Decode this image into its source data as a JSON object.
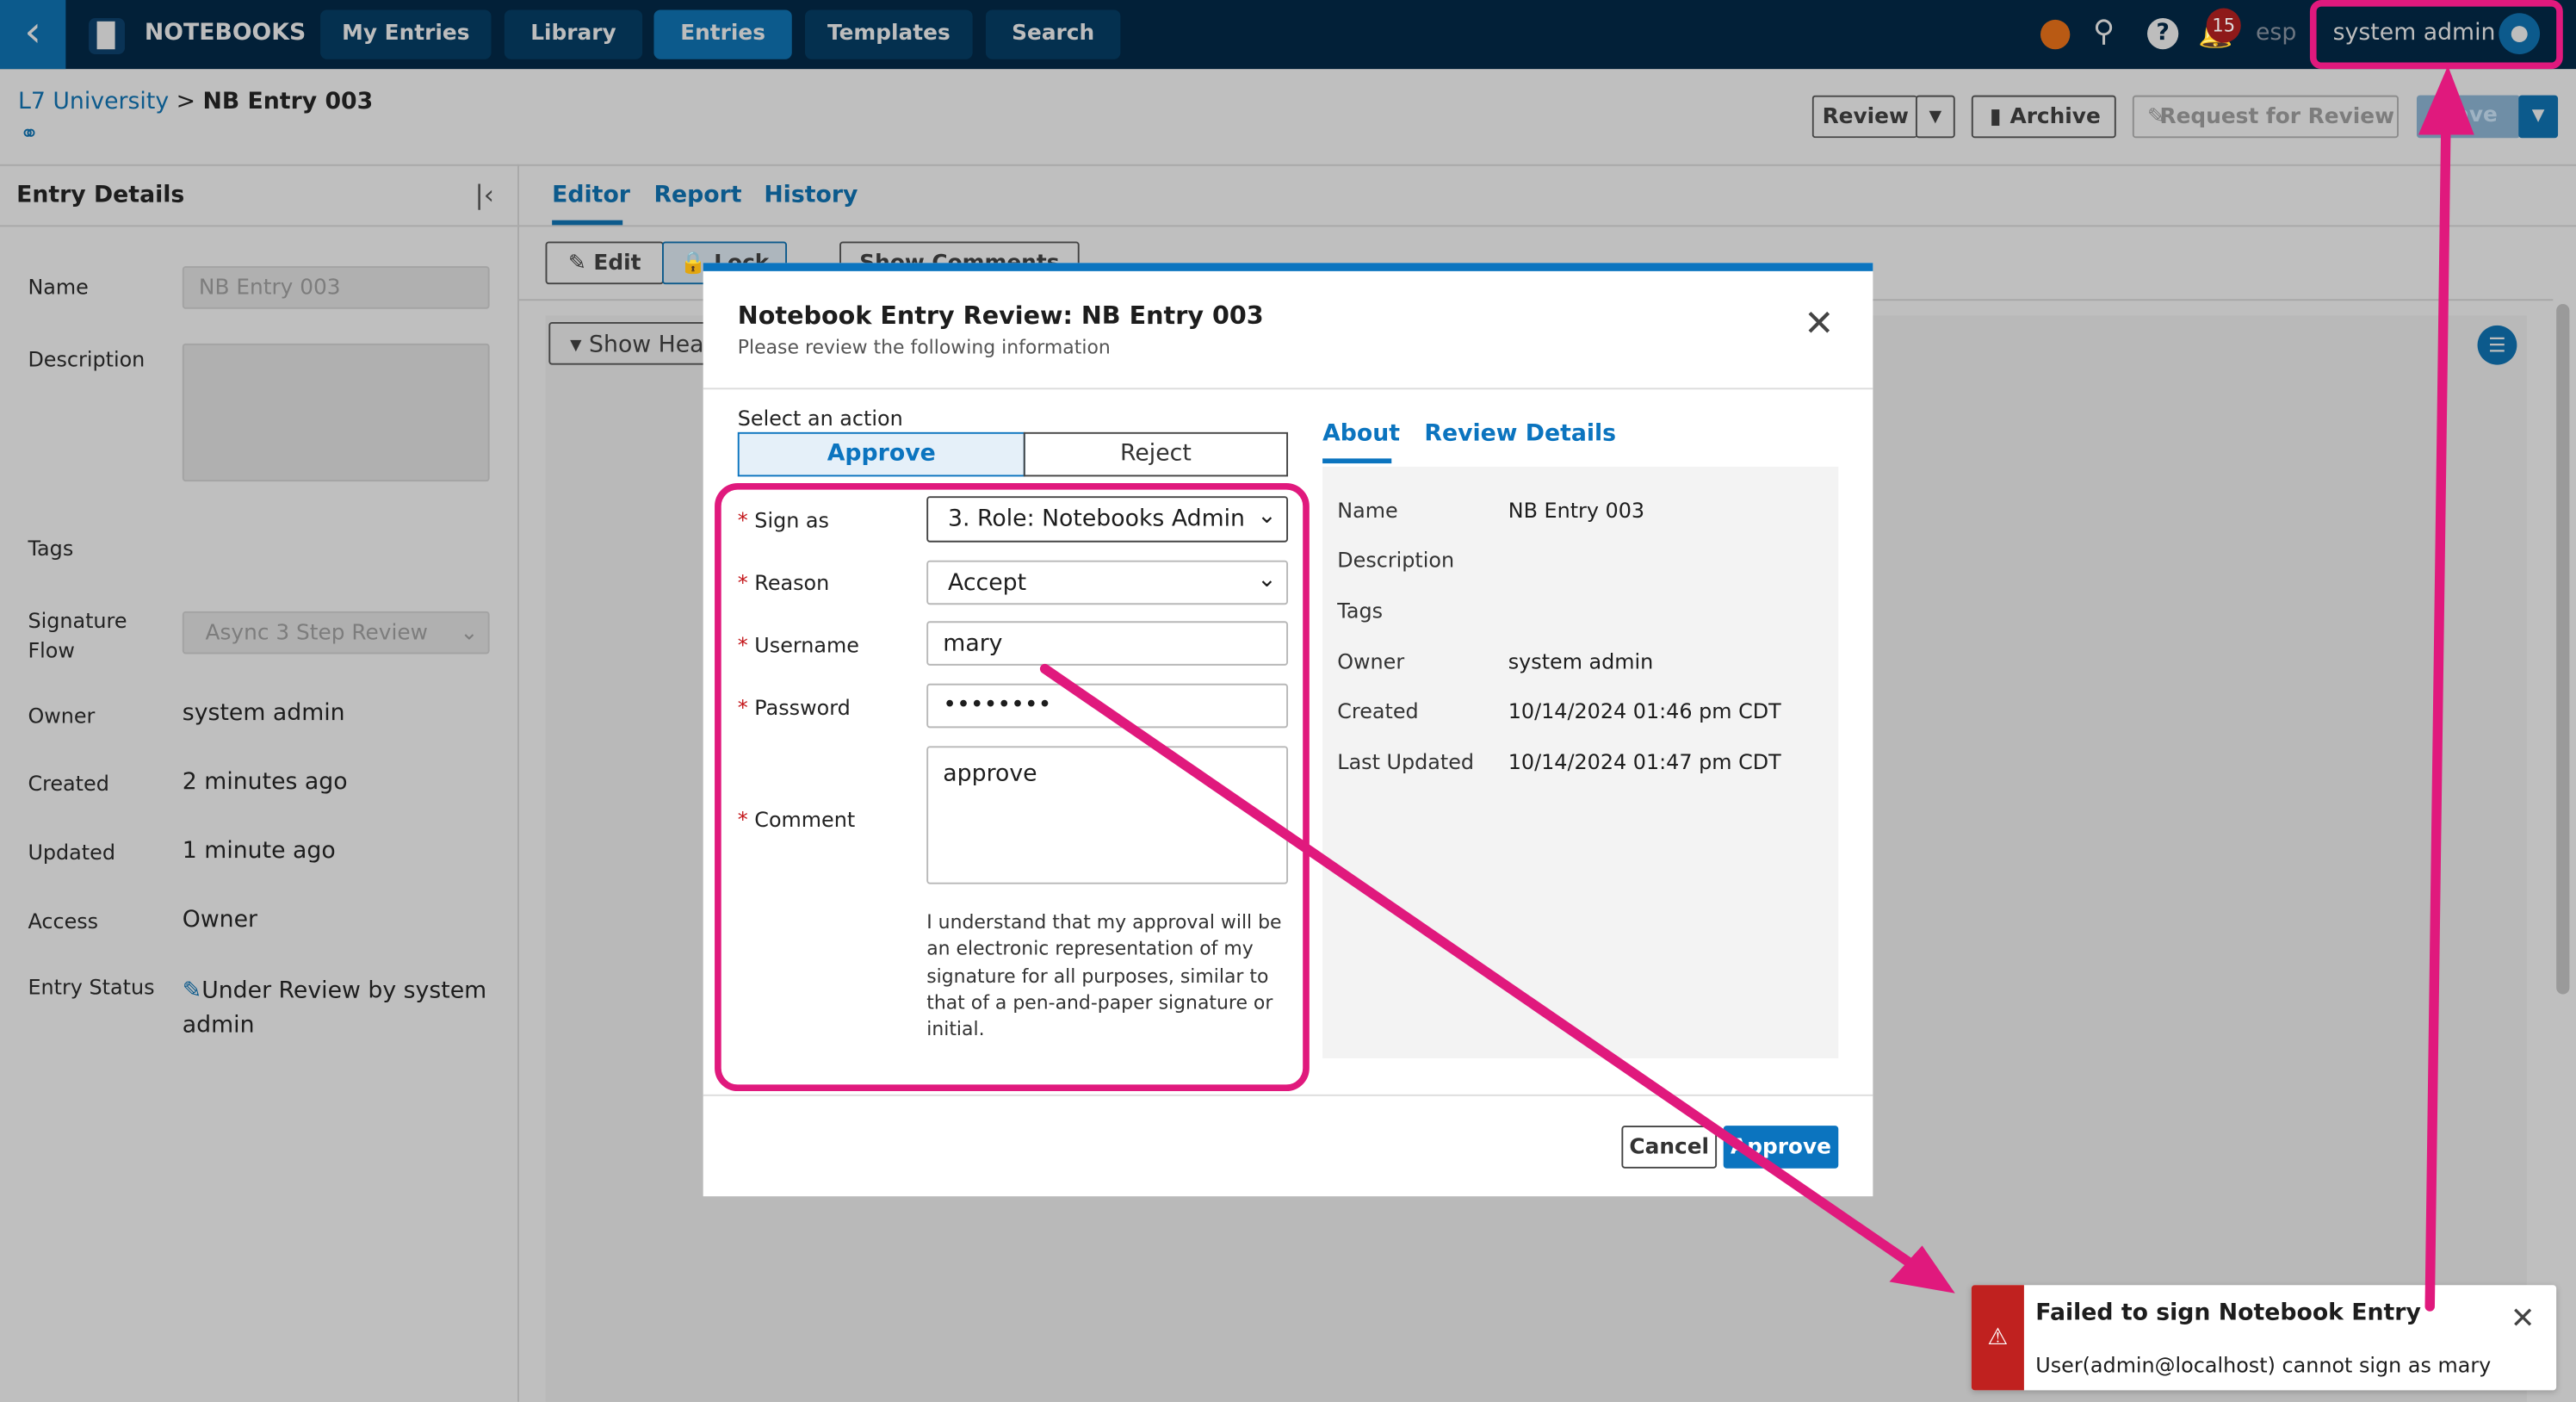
{
  "nav": {
    "brand": "NOTEBOOKS",
    "items": [
      "My Entries",
      "Library",
      "Entries",
      "Templates",
      "Search"
    ],
    "active": "Entries",
    "notification_count": "15",
    "language": "esp",
    "user": "system admin"
  },
  "breadcrumb": {
    "parent": "L7 University",
    "separator": ">",
    "current": "NB Entry 003"
  },
  "toolbar": {
    "review": "Review",
    "archive": "Archive",
    "request_review": "Request for Review",
    "save": "Save"
  },
  "sidebar": {
    "title": "Entry Details",
    "fields": {
      "name_label": "Name",
      "name_value": "NB Entry 003",
      "description_label": "Description",
      "tags_label": "Tags",
      "signature_flow_label": "Signature Flow",
      "signature_flow_value": "Async 3 Step Review",
      "owner_label": "Owner",
      "owner_value": "system admin",
      "created_label": "Created",
      "created_value": "2 minutes ago",
      "updated_label": "Updated",
      "updated_value": "1 minute ago",
      "access_label": "Access",
      "access_value": "Owner",
      "status_label": "Entry Status",
      "status_value": "Under Review by system admin"
    }
  },
  "tabs": [
    "Editor",
    "Report",
    "History"
  ],
  "editor": {
    "edit": "Edit",
    "lock": "Lock",
    "show_comments": "Show Comments",
    "show_header": "Show Header"
  },
  "modal": {
    "title": "Notebook Entry Review: NB Entry 003",
    "subtitle": "Please review the following information",
    "select_action": "Select an action",
    "actions": [
      "Approve",
      "Reject"
    ],
    "selected_action": "Approve",
    "form": {
      "sign_as_label": "Sign as",
      "sign_as_value": "3. Role: Notebooks Admin",
      "reason_label": "Reason",
      "reason_value": "Accept",
      "username_label": "Username",
      "username_value": "mary",
      "password_label": "Password",
      "password_value": "••••••••",
      "comment_label": "Comment",
      "comment_value": "approve",
      "disclaimer": "I understand that my approval will be an electronic representation of my signature for all purposes, similar to that of a pen-and-paper signature or initial."
    },
    "info_tabs": [
      "About",
      "Review Details"
    ],
    "about": [
      {
        "label": "Name",
        "value": "NB Entry 003"
      },
      {
        "label": "Description",
        "value": ""
      },
      {
        "label": "Tags",
        "value": ""
      },
      {
        "label": "Owner",
        "value": "system admin"
      },
      {
        "label": "Created",
        "value": "10/14/2024 01:46 pm CDT"
      },
      {
        "label": "Last Updated",
        "value": "10/14/2024 01:47 pm CDT"
      }
    ],
    "cancel": "Cancel",
    "approve": "Approve"
  },
  "toast": {
    "title": "Failed to sign Notebook Entry",
    "message": "User(admin@localhost) cannot sign as mary",
    "type": "error"
  },
  "colors": {
    "navbar": "#022038",
    "accent": "#0b74bf",
    "annotation": "#e0197d",
    "error": "#c0211f"
  }
}
